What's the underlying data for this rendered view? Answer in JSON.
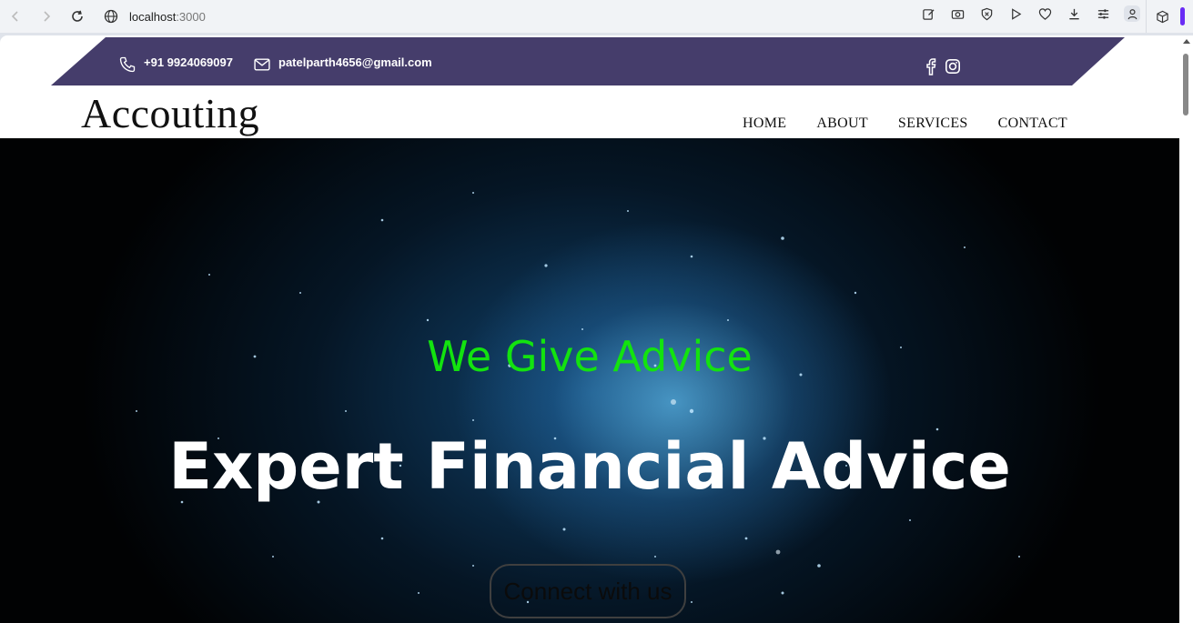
{
  "browser": {
    "url_host": "localhost",
    "url_port": ":3000"
  },
  "topbar": {
    "phone": "+91 9924069097",
    "email": "patelparth4656@gmail.com"
  },
  "header": {
    "logo": "Accouting",
    "nav": [
      "HOME",
      "ABOUT",
      "SERVICES",
      "CONTACT"
    ]
  },
  "hero": {
    "subtitle": "We Give Advice",
    "title": "Expert Financial Advice",
    "cta_label": "Connect with us"
  },
  "colors": {
    "topband": "#453d6b",
    "subtitle": "#13e30f",
    "title": "#ffffff"
  }
}
